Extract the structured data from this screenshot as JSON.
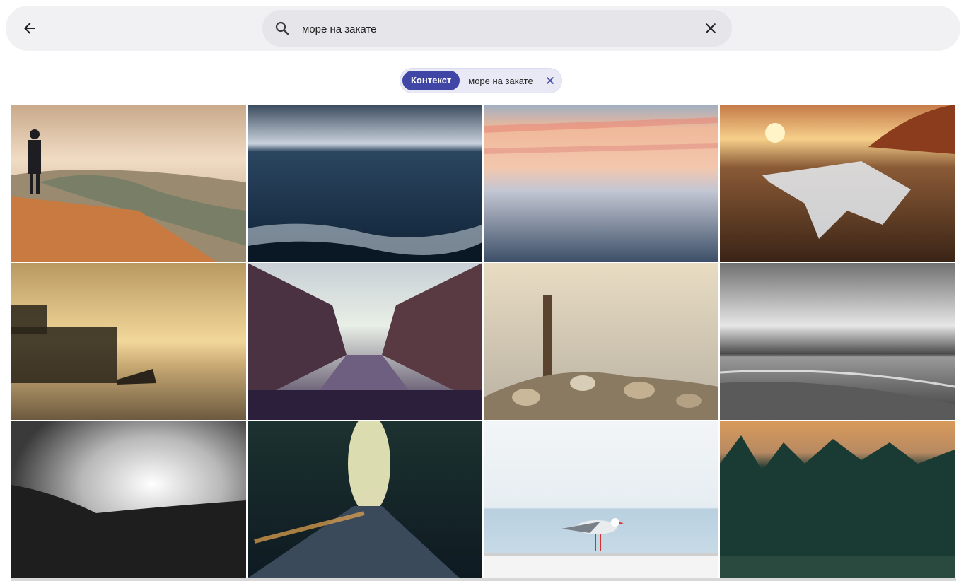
{
  "search": {
    "query": "море на закате",
    "placeholder": ""
  },
  "filter_chip": {
    "tag_label": "Контекст",
    "value": "море на закате"
  },
  "icons": {
    "back": "arrow-left-icon",
    "search": "search-icon",
    "clear": "close-icon",
    "chip_remove": "close-icon"
  },
  "colors": {
    "chip_accent": "#3f46a6",
    "topbar_bg": "#f1f1f3",
    "search_bg": "#e6e6ea"
  },
  "results": [
    {
      "subject": "man on shore at sunset with waves"
    },
    {
      "subject": "dark blue sea waves"
    },
    {
      "subject": "misty pink sunset over sea"
    },
    {
      "subject": "sunset over snowy field and road"
    },
    {
      "subject": "ruined pier at sunset with birds"
    },
    {
      "subject": "city canal at dusk"
    },
    {
      "subject": "wooden post and stones by sea"
    },
    {
      "subject": "black and white seashore"
    },
    {
      "subject": "black and white sunlit landscape"
    },
    {
      "subject": "tree-lined road with sunlight"
    },
    {
      "subject": "seagull on railing by sea"
    },
    {
      "subject": "pine forest at sunset"
    }
  ]
}
